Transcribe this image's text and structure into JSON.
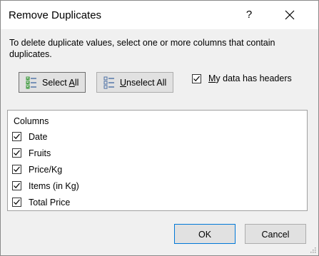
{
  "window": {
    "title": "Remove Duplicates",
    "help_label": "?",
    "close_icon": "close-icon"
  },
  "description": "To delete duplicate values, select one or more columns that contain duplicates.",
  "toolbar": {
    "select_all": {
      "icon": "select-all-icon",
      "prefix": "Select ",
      "accel": "A",
      "suffix": "ll"
    },
    "unselect_all": {
      "icon": "unselect-all-icon",
      "prefix": "",
      "accel": "U",
      "suffix": "nselect All"
    },
    "my_data_headers": {
      "checked": true,
      "prefix": "",
      "accel": "M",
      "suffix": "y data has headers"
    }
  },
  "columns": {
    "header": "Columns",
    "items": [
      {
        "label": "Date",
        "checked": true
      },
      {
        "label": "Fruits",
        "checked": true
      },
      {
        "label": "Price/Kg",
        "checked": true
      },
      {
        "label": "Items (in Kg)",
        "checked": true
      },
      {
        "label": "Total Price",
        "checked": true
      }
    ]
  },
  "footer": {
    "ok_label": "OK",
    "cancel_label": "Cancel"
  },
  "colors": {
    "dialog_bg": "#f0f0f0",
    "accent_border": "#0078d7",
    "icon_green": "#3a9a3a",
    "icon_blue": "#4a6fa5"
  }
}
